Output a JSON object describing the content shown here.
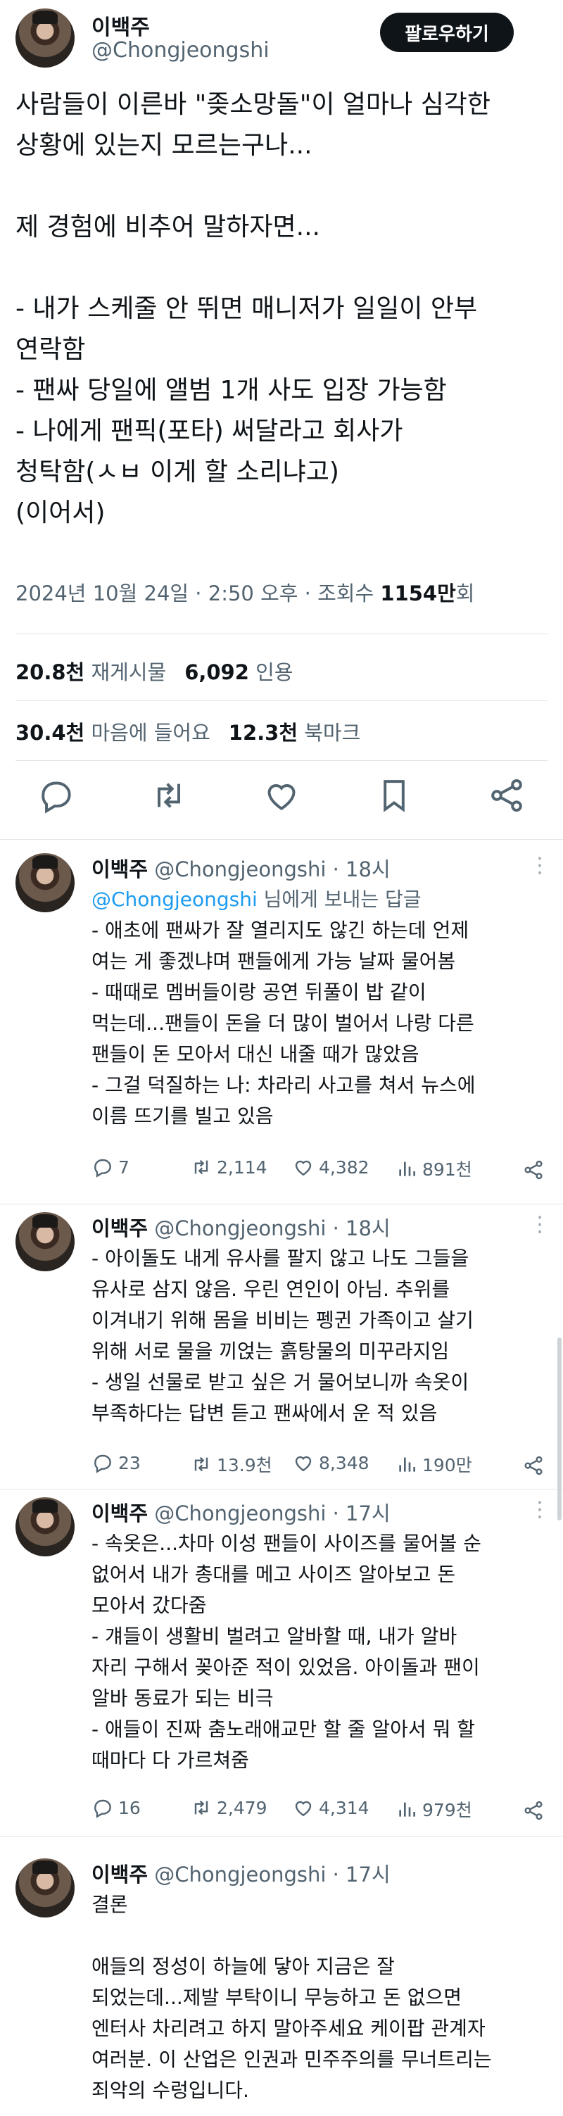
{
  "main": {
    "name": "이백주",
    "handle": "@Chongjeongshi",
    "follow_label": "팔로우하기",
    "text": "사람들이 이른바 \"좆소망돌\"이 얼마나 심각한\n상황에 있는지 모르는구나...\n\n제 경험에 비추어 말하자면...\n\n- 내가 스케줄 안 뛰면 매니저가 일일이 안부\n연락함\n- 팬싸 당일에 앨범 1개 사도 입장 가능함\n- 나에게 팬픽(포타) 써달라고 회사가\n청탁함(ㅅㅂ 이게 할 소리냐고)\n(이어서)",
    "date": "2024년 10월 24일 · 2:50 오후 · 조회수 ",
    "views": "1154만",
    "views_suffix": "회",
    "reposts": "20.8천",
    "reposts_label": "재게시물",
    "quotes": "6,092",
    "quotes_label": "인용",
    "likes": "30.4천",
    "likes_label": "마음에 들어요",
    "bookmarks": "12.3천",
    "bookmarks_label": "북마크"
  },
  "replies": [
    {
      "name": "이백주",
      "handle": "@Chongjeongshi · 18시",
      "reply_to_handle": "@Chongjeongshi",
      "reply_to_suffix": " 님에게 보내는 답글",
      "text": "- 애초에 팬싸가 잘 열리지도 않긴 하는데 언제\n여는 게 좋겠냐며 팬들에게 가능 날짜 물어봄\n- 때때로 멤버들이랑 공연 뒤풀이 밥 같이\n먹는데...팬들이 돈을 더 많이 벌어서 나랑 다른\n팬들이 돈 모아서 대신 내줄 때가 많았음\n- 그걸 덕질하는 나: 차라리 사고를 쳐서 뉴스에\n이름 뜨기를 빌고 있음",
      "comments": "7",
      "reposts": "2,114",
      "likes": "4,382",
      "views": "891천"
    },
    {
      "name": "이백주",
      "handle": "@Chongjeongshi · 18시",
      "text": "- 아이돌도 내게 유사를 팔지 않고 나도 그들을\n유사로 삼지 않음. 우린 연인이 아님. 추위를\n이겨내기 위해 몸을 비비는 펭귄 가족이고 살기\n위해 서로 물을 끼얹는 흙탕물의 미꾸라지임\n- 생일 선물로 받고 싶은 거 물어보니까 속옷이\n부족하다는 답변 듣고 팬싸에서 운 적 있음",
      "comments": "23",
      "reposts": "13.9천",
      "likes": "8,348",
      "views": "190만"
    },
    {
      "name": "이백주",
      "handle": "@Chongjeongshi · 17시",
      "text": "- 속옷은...차마 이성 팬들이 사이즈를 물어볼 순\n없어서 내가 총대를 메고 사이즈 알아보고 돈\n모아서 갔다줌\n- 걔들이 생활비 벌려고 알바할 때, 내가 알바\n자리 구해서 꽂아준 적이 있었음. 아이돌과 팬이\n알바 동료가 되는 비극\n- 애들이 진짜 춤노래애교만 할 줄 알아서 뭐 할\n때마다 다 가르쳐줌",
      "comments": "16",
      "reposts": "2,479",
      "likes": "4,314",
      "views": "979천"
    },
    {
      "name": "이백주",
      "handle": "@Chongjeongshi · 17시",
      "text": "결론\n\n애들의 정성이 하늘에 닿아 지금은 잘\n되었는데...제발 부탁이니 무능하고 돈 없으면\n엔터사 차리려고 하지 말아주세요 케이팝 관계자\n여러분. 이 산업은 인권과 민주주의를 무너트리는\n죄악의 수렁입니다."
    }
  ],
  "icons": {
    "reply": "speech-bubble-icon",
    "repost": "repost-arrows-icon",
    "like": "heart-icon",
    "views": "bar-chart-icon",
    "bookmark": "bookmark-icon",
    "share": "share-icon",
    "more": "more-dots-icon"
  },
  "colors": {
    "link": "#1d9bf0",
    "secondary_text": "#536471",
    "primary_text": "#0f1419"
  }
}
